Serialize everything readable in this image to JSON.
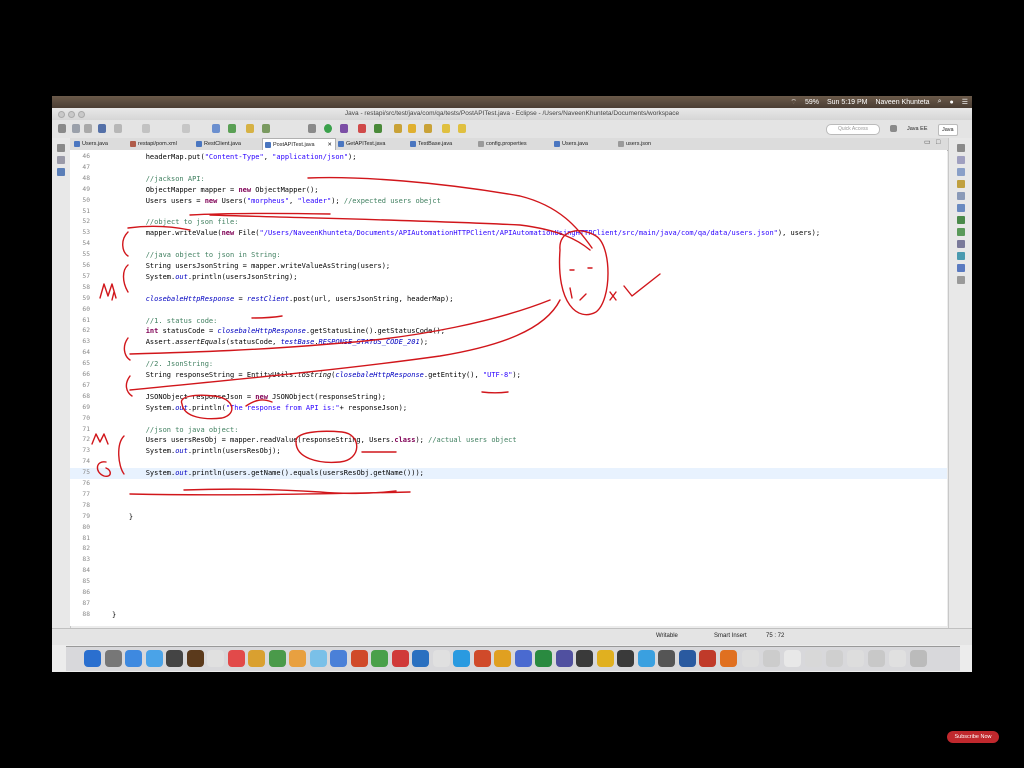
{
  "menubar": {
    "battery": "59%",
    "clock": "Sun 5:19 PM",
    "user": "Naveen Khunteta"
  },
  "window": {
    "title": "Java - restapi/src/test/java/com/qa/tests/PostAPITest.java - Eclipse - /Users/NaveenKhunteta/Documents/workspace"
  },
  "toolbar": {
    "quick_access_placeholder": "Quick Access",
    "perspectives": [
      "Java EE",
      "Java"
    ]
  },
  "tabs": [
    {
      "label": "Users.java"
    },
    {
      "label": "restapi/pom.xml"
    },
    {
      "label": "RestClient.java"
    },
    {
      "label": "PostAPITest.java",
      "active": true
    },
    {
      "label": "GetAPITest.java"
    },
    {
      "label": "TestBase.java"
    },
    {
      "label": "config.properties"
    },
    {
      "label": "Users.java"
    },
    {
      "label": "users.json"
    }
  ],
  "editor": {
    "lines": [
      {
        "n": "46",
        "html": "        headerMap.put(<span class=\"str\">\"Content-Type\"</span>, <span class=\"str\">\"application/json\"</span>);"
      },
      {
        "n": "47",
        "html": ""
      },
      {
        "n": "48",
        "html": "        <span class=\"cm\">//jackson API:</span>"
      },
      {
        "n": "49",
        "html": "        ObjectMapper mapper = <span class=\"kw\">new</span> ObjectMapper();"
      },
      {
        "n": "50",
        "html": "        Users users = <span class=\"kw\">new</span> Users(<span class=\"str\">\"morpheus\"</span>, <span class=\"str\">\"leader\"</span>); <span class=\"cm\">//expected users obejct</span>"
      },
      {
        "n": "51",
        "html": ""
      },
      {
        "n": "52",
        "html": "        <span class=\"cm\">//object to json file:</span>"
      },
      {
        "n": "53",
        "html": "        mapper.writeValue(<span class=\"kw\">new</span> File(<span class=\"str\">\"/Users/NaveenKhunteta/Documents/APIAutomationHTTPClient/APIAutomationUsingHTTPClient/src/main/java/com/qa/data/users.json\"</span>), users);"
      },
      {
        "n": "54",
        "html": ""
      },
      {
        "n": "55",
        "html": "        <span class=\"cm\">//java object to json in String:</span>"
      },
      {
        "n": "56",
        "html": "        String usersJsonString = mapper.writeValueAsString(users);"
      },
      {
        "n": "57",
        "html": "        System.<span class=\"fld\">out</span>.println(usersJsonString);"
      },
      {
        "n": "58",
        "html": ""
      },
      {
        "n": "59",
        "html": "        <span class=\"fld\">closebaleHttpResponse</span> = <span class=\"fld\">restClient</span>.post(url, usersJsonString, headerMap);"
      },
      {
        "n": "60",
        "html": ""
      },
      {
        "n": "61",
        "html": "        <span class=\"cm\">//1. status code:</span>"
      },
      {
        "n": "62",
        "html": "        <span class=\"kw\">int</span> statusCode = <span class=\"fld\">closebaleHttpResponse</span>.getStatusLine().getStatusCode();"
      },
      {
        "n": "63",
        "html": "        Assert.<span class=\"st\">assertEquals</span>(statusCode, <span class=\"fld\">testBase</span>.<span class=\"fld\">RESPONSE_STATUS_CODE_201</span>);"
      },
      {
        "n": "64",
        "html": ""
      },
      {
        "n": "65",
        "html": "        <span class=\"cm\">//2. JsonString:</span>"
      },
      {
        "n": "66",
        "html": "        String responseString = EntityUtils.<span class=\"st\">toString</span>(<span class=\"fld\">closebaleHttpResponse</span>.getEntity(), <span class=\"str\">\"UTF-8\"</span>);"
      },
      {
        "n": "67",
        "html": ""
      },
      {
        "n": "68",
        "html": "        JSONObject responseJson = <span class=\"kw\">new</span> JSONObject(responseString);"
      },
      {
        "n": "69",
        "html": "        System.<span class=\"fld\">out</span>.println(<span class=\"str\">\"The response from API is:\"</span>+ responseJson);"
      },
      {
        "n": "70",
        "html": ""
      },
      {
        "n": "71",
        "html": "        <span class=\"cm\">//json to java object:</span>"
      },
      {
        "n": "72",
        "html": "        Users usersResObj = mapper.readValue(responseString, Users.<span class=\"kw\">class</span>); <span class=\"cm\">//actual users object</span>"
      },
      {
        "n": "73",
        "html": "        System.<span class=\"fld\">out</span>.println(usersResObj);"
      },
      {
        "n": "74",
        "html": ""
      },
      {
        "n": "75",
        "html": "        System.<span class=\"fld\">out</span>.println(users.getName().equals(usersResObj.getName()));",
        "current": true
      },
      {
        "n": "76",
        "html": ""
      },
      {
        "n": "77",
        "html": ""
      },
      {
        "n": "78",
        "html": ""
      },
      {
        "n": "79",
        "html": "    }"
      },
      {
        "n": "80",
        "html": ""
      },
      {
        "n": "81",
        "html": ""
      },
      {
        "n": "82",
        "html": ""
      },
      {
        "n": "83",
        "html": ""
      },
      {
        "n": "84",
        "html": ""
      },
      {
        "n": "85",
        "html": ""
      },
      {
        "n": "86",
        "html": ""
      },
      {
        "n": "87",
        "html": ""
      },
      {
        "n": "88",
        "html": "}"
      }
    ]
  },
  "statusbar": {
    "writable": "Writable",
    "insert_mode": "Smart Insert",
    "position": "75 : 72"
  },
  "overlay": {
    "subscribe": "Subscribe Now"
  },
  "colors": {
    "ink": "#d1161b",
    "current_line": "#e8f2fe",
    "keyword": "#7f0055",
    "string": "#2a00ff",
    "comment": "#3f7f5f"
  }
}
